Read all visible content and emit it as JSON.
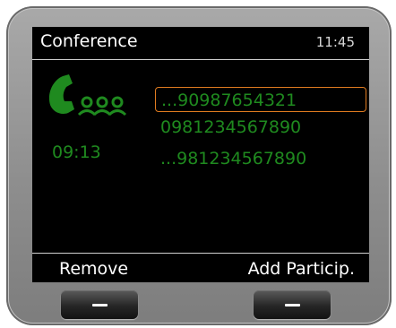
{
  "header": {
    "title": "Conference",
    "time": "11:45"
  },
  "call": {
    "icon": "conference-call-icon",
    "duration": "09:13"
  },
  "participants": [
    {
      "number": "...90987654321",
      "selected": true
    },
    {
      "number": "0981234567890",
      "selected": false
    },
    {
      "number": "...981234567890",
      "selected": false
    }
  ],
  "softkeys": {
    "left_label": "Remove",
    "right_label": "Add Particip."
  },
  "colors": {
    "text_green": "#1f8a1f",
    "selection_orange": "#e07b20",
    "screen_background": "#000000"
  }
}
